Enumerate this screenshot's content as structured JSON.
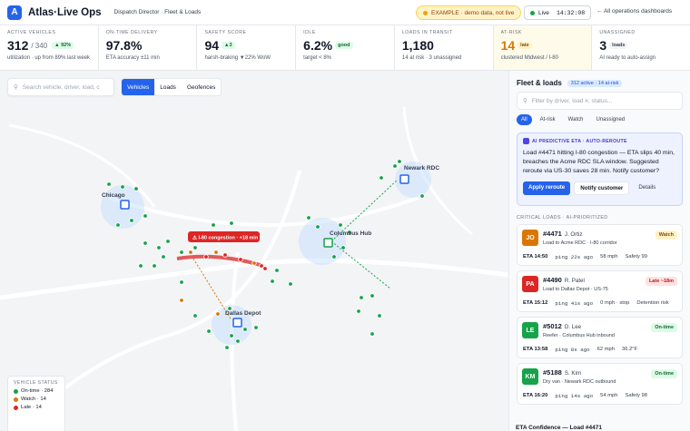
{
  "header": {
    "logo_letter": "A",
    "app_name": "Atlas·Live Ops",
    "breadcrumb": "Dispatch Director · Fleet & Loads",
    "example_badge": "EXAMPLE · demo data, not live",
    "live_label": "Live",
    "clock": "14:32:08",
    "all_dashboards": "All operations dashboards"
  },
  "kpis": [
    {
      "label": "ACTIVE VEHICLES",
      "value": "312",
      "value_suffix": "/ 340",
      "badge": "▲ 92%",
      "sub": "utilization · up from 89% last week"
    },
    {
      "label": "ON-TIME DELIVERY",
      "value": "97.8%",
      "sub": "ETA accuracy ±11 min"
    },
    {
      "label": "SAFETY SCORE",
      "value": "94",
      "badge": "▲3",
      "sub": "harsh-braking ▼22% WoW"
    },
    {
      "label": "IDLE",
      "value": "6.2%",
      "badge": "good",
      "sub": "target < 8%"
    },
    {
      "label": "LOADS IN TRANSIT",
      "value": "1,180",
      "sub": "14 at risk · 3 unassigned"
    },
    {
      "label": "AT-RISK",
      "value": "14",
      "badge": "late",
      "sub": "clustered Midwest / I-80"
    },
    {
      "label": "UNASSIGNED",
      "value": "3",
      "badge": "loads",
      "sub": "AI ready to auto-assign"
    }
  ],
  "map": {
    "search_placeholder": "Search vehicle, driver, load, c",
    "tabs": [
      "Vehicles",
      "Loads",
      "Geofences"
    ],
    "hubs": [
      "Chicago",
      "Newark RDC",
      "Columbus Hub",
      "Dallas Depot"
    ],
    "congestion_label": "⚠ I-80 congestion · +18 min",
    "legend_title": "VEHICLE STATUS",
    "legend": [
      {
        "label": "On-time · 284",
        "color": "#16a34a"
      },
      {
        "label": "Watch · 14",
        "color": "#d97706"
      },
      {
        "label": "Late · 14",
        "color": "#dc2626"
      }
    ]
  },
  "panel": {
    "title": "Fleet & loads",
    "count": "312 active · 14 at-risk",
    "search_placeholder": "Filter by driver, load #, status...",
    "filters": [
      "All",
      "At-risk",
      "Watch",
      "Unassigned"
    ],
    "ai": {
      "header": "AI PREDICTIVE ETA · AUTO-REROUTE",
      "body": "Load #4471 hitting I-80 congestion — ETA slips 40 min, breaches the Acme RDC SLA window. Suggested reroute via US-30 saves 28 min. Notify customer?",
      "apply": "Apply reroute",
      "notify": "Notify customer",
      "details": "Details"
    },
    "section": "CRITICAL LOADS · AI-PRIORITIZED",
    "cards": [
      {
        "initials": "JO",
        "color": "#d97706",
        "load": "#4471",
        "driver": "J. Ortiz",
        "route": "Load to Acme RDC · I-80 corridor",
        "status": "Watch",
        "status_bg": "#fef3c7",
        "status_fg": "#92400e",
        "eta": "ETA 14:50",
        "ping": "ping 22s ago",
        "speed": "58 mph",
        "extra": "Safety 99"
      },
      {
        "initials": "PA",
        "color": "#dc2626",
        "load": "#4490",
        "driver": "R. Patel",
        "route": "Load to Dallas Depot · US-75",
        "status": "Late ~18m",
        "status_bg": "#fee2e2",
        "status_fg": "#b91c1c",
        "eta": "ETA 15:12",
        "ping": "ping 41s ago",
        "speed": "0 mph · stop",
        "extra": "Detention risk"
      },
      {
        "initials": "LE",
        "color": "#16a34a",
        "load": "#5012",
        "driver": "D. Lee",
        "route": "Reefer · Columbus Hub inbound",
        "status": "On-time",
        "status_bg": "#dcfce7",
        "status_fg": "#166534",
        "eta": "ETA 13:58",
        "ping": "ping 8s ago",
        "speed": "62 mph",
        "extra": "36.2°F"
      },
      {
        "initials": "KM",
        "color": "#16a34a",
        "load": "#5188",
        "driver": "S. Kim",
        "route": "Dry van · Newark RDC outbound",
        "status": "On-time",
        "status_bg": "#dcfce7",
        "status_fg": "#166534",
        "eta": "ETA 16:20",
        "ping": "ping 14s ago",
        "speed": "54 mph",
        "extra": "Safety 98"
      }
    ],
    "bottom": "ETA Confidence — Load #4471"
  }
}
